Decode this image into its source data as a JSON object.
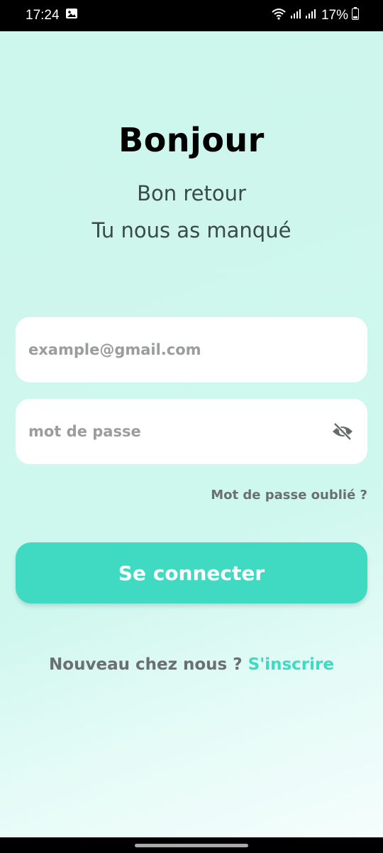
{
  "status_bar": {
    "time": "17:24",
    "battery_percent": "17%",
    "icons": [
      "image-icon",
      "wifi-icon",
      "signal-icon",
      "signal-icon",
      "battery-icon"
    ]
  },
  "header": {
    "greeting": "Bonjour",
    "subtitle_line1": "Bon retour",
    "subtitle_line2": "Tu nous as manqué"
  },
  "form": {
    "email_placeholder": "example@gmail.com",
    "password_placeholder": "mot de passe",
    "forgot_password": "Mot de passe oublié ?",
    "login_label": "Se connecter"
  },
  "signup": {
    "prompt": "Nouveau chez nous ?",
    "link": "S'inscrire"
  },
  "colors": {
    "background": "#cdf6ec",
    "accent": "#40d9c1",
    "muted_text": "#6b6f6e"
  }
}
